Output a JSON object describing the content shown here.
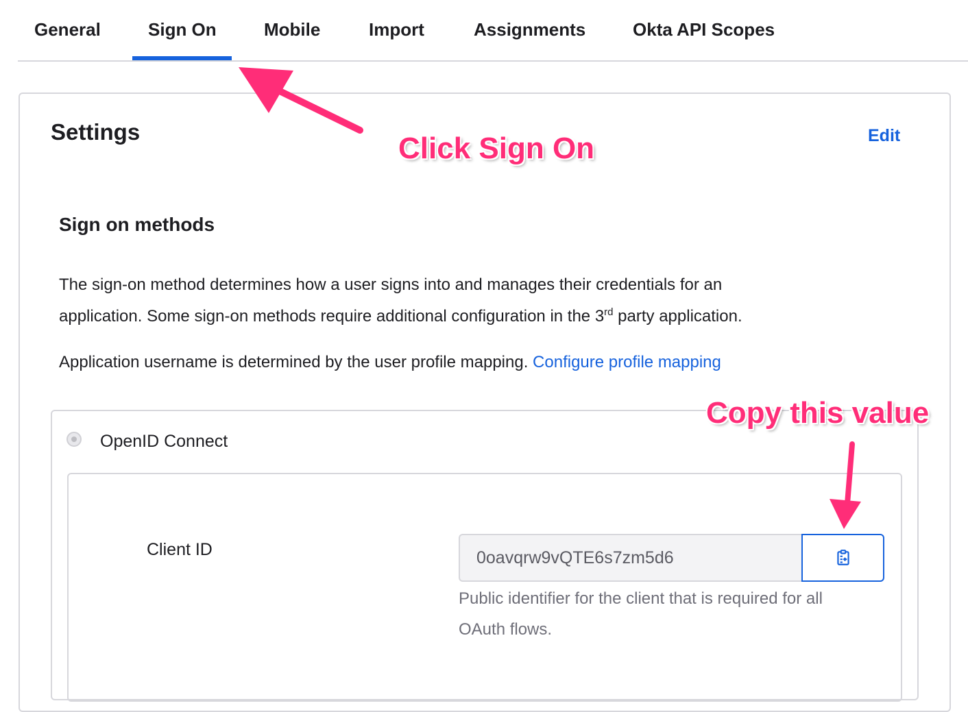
{
  "tabs": [
    {
      "label": "General"
    },
    {
      "label": "Sign On"
    },
    {
      "label": "Mobile"
    },
    {
      "label": "Import"
    },
    {
      "label": "Assignments"
    },
    {
      "label": "Okta API Scopes"
    }
  ],
  "active_tab": "Sign On",
  "settings": {
    "title": "Settings",
    "edit_label": "Edit",
    "methods_title": "Sign on methods",
    "desc_line1": "The sign-on method determines how a user signs into and manages their credentials for an",
    "desc_line2_pre": "application. Some sign-on methods require additional configuration in the 3",
    "desc_line2_sup": "rd",
    "desc_line2_post": " party application.",
    "username_text": "Application username is determined by the user profile mapping.",
    "configure_link": "Configure profile mapping"
  },
  "openid": {
    "label": "OpenID Connect",
    "client_id_label": "Client ID",
    "client_id_value": "0oavqrw9vQTE6s7zm5d6",
    "hint_line1": "Public identifier for the client that is required for all",
    "hint_line2": "OAuth flows.",
    "copy_icon": "clipboard-copy-icon"
  },
  "annotations": {
    "click_sign_on": "Click Sign On",
    "copy_value": "Copy this value"
  },
  "colors": {
    "accent": "#1662dd",
    "annotation": "#ff2d78"
  }
}
